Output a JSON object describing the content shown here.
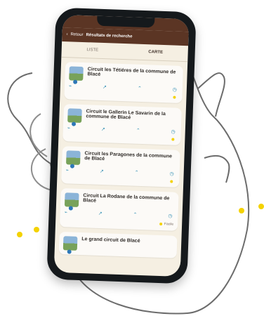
{
  "status": {
    "time": "",
    "signal": ""
  },
  "header": {
    "back_label": "Retour",
    "title": "Résultats de recherche"
  },
  "tabs": [
    {
      "label": "LISTE"
    },
    {
      "label": "CARTE"
    }
  ],
  "cards": [
    {
      "title": "Circuit les Tétiéres de la commune de Blacé",
      "distance": "",
      "elevation": "",
      "altitude": "",
      "time": "",
      "duration": "",
      "difficulty": ""
    },
    {
      "title": "Circuit le Gallerin Le Savarin de la commune de Blacé",
      "distance": "",
      "elevation": "",
      "altitude": "",
      "time": "",
      "duration": "",
      "difficulty": ""
    },
    {
      "title": "Circuit les Paragones de la commune de Blacé",
      "distance": "",
      "elevation": "",
      "altitude": "",
      "time": "",
      "duration": "",
      "difficulty": ""
    },
    {
      "title": "Circuit La Rodane de la commune de Blacé",
      "distance": "",
      "elevation": "",
      "altitude": "",
      "time": "",
      "duration": "",
      "difficulty": "Facile"
    },
    {
      "title": "Le grand circuit de Blacé",
      "distance": "",
      "elevation": "",
      "altitude": "",
      "time": "",
      "duration": "",
      "difficulty": ""
    }
  ],
  "colors": {
    "accent": "#2f8db3",
    "header": "#5b3524"
  }
}
